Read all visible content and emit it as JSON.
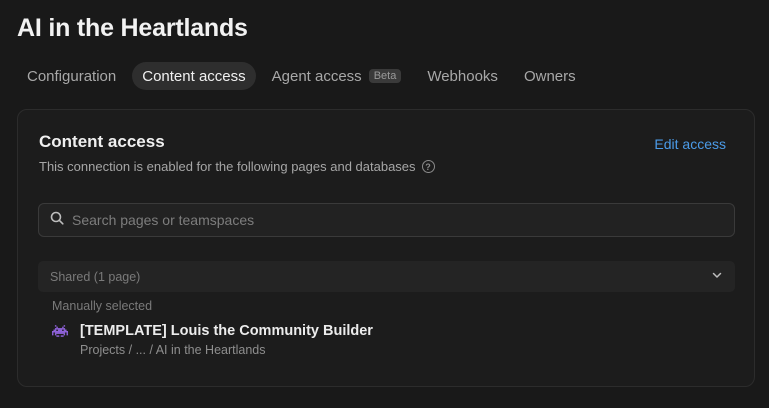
{
  "header": {
    "title": "AI in the Heartlands"
  },
  "tabs": [
    {
      "label": "Configuration",
      "active": false
    },
    {
      "label": "Content access",
      "active": true
    },
    {
      "label": "Agent access",
      "active": false,
      "badge": "Beta"
    },
    {
      "label": "Webhooks",
      "active": false
    },
    {
      "label": "Owners",
      "active": false
    }
  ],
  "content": {
    "title": "Content access",
    "description": "This connection is enabled for the following pages and databases",
    "edit_label": "Edit access",
    "search": {
      "placeholder": "Search pages or teamspaces",
      "value": ""
    },
    "shared_section": {
      "label": "Shared (1 page)",
      "subheading": "Manually selected",
      "pages": [
        {
          "icon": "space-invader-icon",
          "name": "[TEMPLATE] Louis the Community Builder",
          "path": "Projects / ... / AI in the Heartlands"
        }
      ]
    }
  },
  "colors": {
    "background": "#191919",
    "accent": "#4b9be8",
    "active_tab": "#2e2e2e"
  }
}
